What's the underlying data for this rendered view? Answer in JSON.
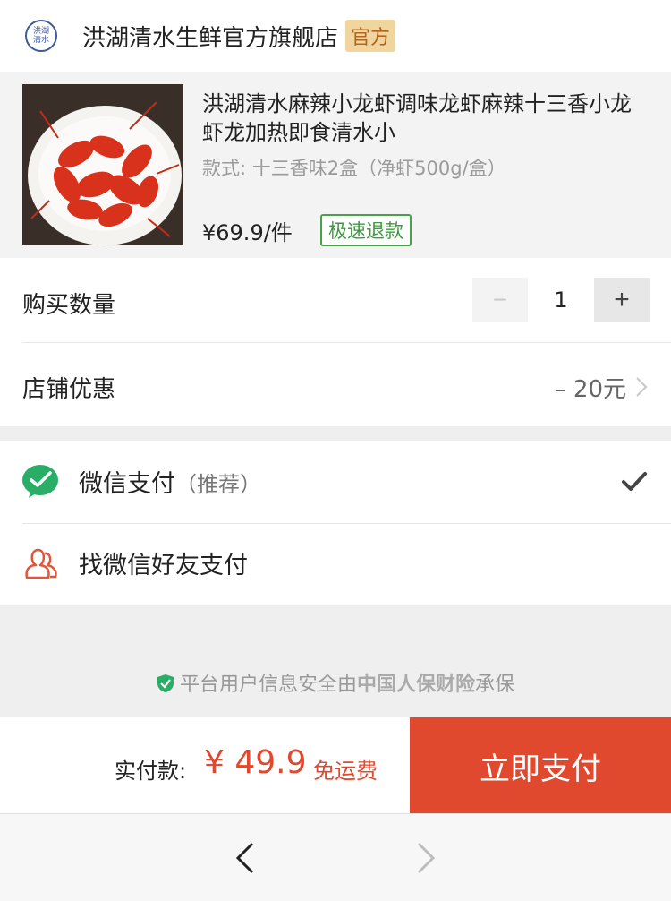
{
  "store": {
    "logo_text": "洪湖\n清水",
    "name": "洪湖清水生鲜官方旗舰店",
    "badge": "官方"
  },
  "product": {
    "title": "洪湖清水麻辣小龙虾调味龙虾麻辣十三香小龙虾龙加热即食清水小",
    "spec": "款式: 十三香味2盒（净虾500g/盒）",
    "price": "¥69.9/件",
    "refund_badge": "极速退款"
  },
  "quantity": {
    "label": "购买数量",
    "minus": "−",
    "value": "1",
    "plus": "+"
  },
  "discount": {
    "label": "店铺优惠",
    "value": "– 20元"
  },
  "payment": {
    "wechat_label": "微信支付",
    "wechat_recommend": "（推荐）",
    "friend_label": "找微信好友支付"
  },
  "security": {
    "prefix": "平台用户信息安全由",
    "insurer": "中国人保财险",
    "suffix": "承保"
  },
  "footer": {
    "total_label": "实付款:",
    "total_amount": "¥ 49.9",
    "free_shipping": "免运费",
    "pay_button": "立即支付"
  },
  "colors": {
    "accent": "#e0492e",
    "wechat_green": "#2aae67",
    "badge_bg": "#f0d59e"
  },
  "icons": [
    "shield-icon",
    "wechat-pay-icon",
    "friends-icon",
    "check-icon",
    "chevron-right-icon",
    "back-icon",
    "forward-icon"
  ]
}
